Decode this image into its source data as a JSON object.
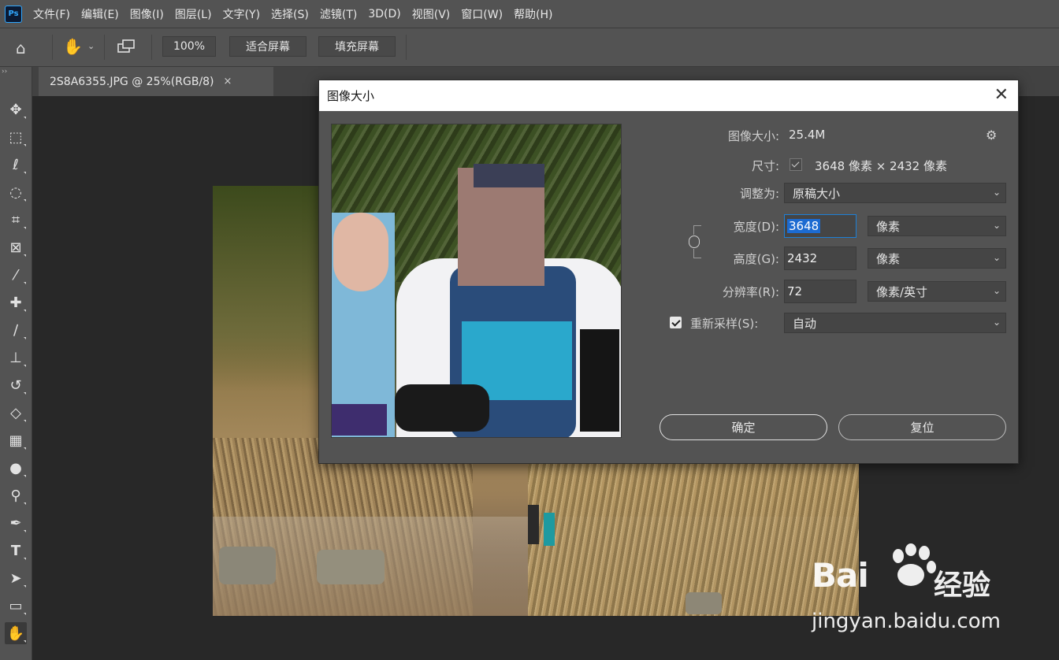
{
  "app": {
    "logo": "Ps"
  },
  "menu": [
    "文件(F)",
    "编辑(E)",
    "图像(I)",
    "图层(L)",
    "文字(Y)",
    "选择(S)",
    "滤镜(T)",
    "3D(D)",
    "视图(V)",
    "窗口(W)",
    "帮助(H)"
  ],
  "options": {
    "zoom_label": "100%",
    "fit_label": "适合屏幕",
    "fill_label": "填充屏幕"
  },
  "tab": {
    "title": "2S8A6355.JPG @ 25%(RGB/8)",
    "close": "×"
  },
  "tools": [
    "move-tool",
    "marquee-tool",
    "lasso-tool",
    "quick-select-tool",
    "crop-tool",
    "frame-tool",
    "eyedropper-tool",
    "healing-tool",
    "brush-tool",
    "stamp-tool",
    "history-brush-tool",
    "eraser-tool",
    "gradient-tool",
    "blur-tool",
    "dodge-tool",
    "pen-tool",
    "type-tool",
    "path-select-tool",
    "rectangle-tool",
    "hand-tool"
  ],
  "dialog": {
    "title": "图像大小",
    "image_size_label": "图像大小:",
    "image_size_value": "25.4M",
    "dimensions_label": "尺寸:",
    "dimensions_value": "3648 像素  ×  2432 像素",
    "fit_to_label": "调整为:",
    "fit_to_value": "原稿大小",
    "width_label": "宽度(D):",
    "width_value": "3648",
    "width_unit": "像素",
    "height_label": "高度(G):",
    "height_value": "2432",
    "height_unit": "像素",
    "resolution_label": "分辨率(R):",
    "resolution_value": "72",
    "resolution_unit": "像素/英寸",
    "resample_label": "重新采样(S):",
    "resample_value": "自动",
    "ok_label": "确定",
    "reset_label": "复位"
  },
  "watermark": {
    "brand": "Bai",
    "brand2": "经验",
    "url": "jingyan.baidu.com"
  }
}
